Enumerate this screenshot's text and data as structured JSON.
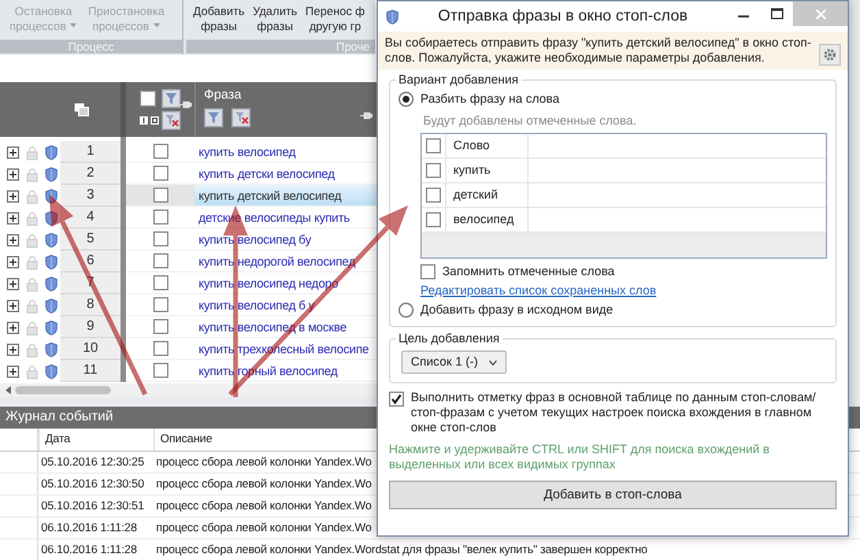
{
  "ribbon": {
    "groups": [
      {
        "label": "Процесс",
        "buttons": [
          {
            "lines": [
              "Остановка",
              "процессов"
            ],
            "has_menu": true,
            "disabled": true
          },
          {
            "lines": [
              "Приостановка",
              "процессов"
            ],
            "has_menu": true,
            "disabled": true
          }
        ]
      },
      {
        "label": "Проче",
        "buttons": [
          {
            "lines": [
              "Добавить",
              "фразы"
            ],
            "has_menu": false,
            "disabled": false
          },
          {
            "lines": [
              "Удалить",
              "фразы"
            ],
            "has_menu": false,
            "disabled": false
          },
          {
            "lines": [
              "Перенос ф",
              "другую гр"
            ],
            "has_menu": false,
            "disabled": false
          }
        ]
      }
    ]
  },
  "grid": {
    "phrase_column": "Фраза",
    "all_checked": false,
    "rows": [
      {
        "number": "1",
        "checked": false,
        "selected": false,
        "phrase": "купить велосипед"
      },
      {
        "number": "2",
        "checked": false,
        "selected": false,
        "phrase": "купить детски велосипед"
      },
      {
        "number": "3",
        "checked": false,
        "selected": true,
        "phrase": "купить детский велосипед"
      },
      {
        "number": "4",
        "checked": false,
        "selected": false,
        "phrase": "детские велосипеды купить"
      },
      {
        "number": "5",
        "checked": false,
        "selected": false,
        "phrase": "купить велосипед бу"
      },
      {
        "number": "6",
        "checked": false,
        "selected": false,
        "phrase": "купить недорогой велосипед"
      },
      {
        "number": "7",
        "checked": false,
        "selected": false,
        "phrase": "купить велосипед недоро"
      },
      {
        "number": "8",
        "checked": false,
        "selected": false,
        "phrase": "купить велосипед б у"
      },
      {
        "number": "9",
        "checked": false,
        "selected": false,
        "phrase": "купить велосипед в москве"
      },
      {
        "number": "10",
        "checked": false,
        "selected": false,
        "phrase": "купить трехколесный велосипе"
      },
      {
        "number": "11",
        "checked": false,
        "selected": false,
        "phrase": "купить горный велосипед"
      }
    ]
  },
  "event_log": {
    "title": "Журнал событий",
    "columns": [
      "Дата",
      "Описание"
    ],
    "rows": [
      {
        "date": "05.10.2016 12:30:25",
        "description": "процесс сбора левой колонки Yandex.Wo"
      },
      {
        "date": "05.10.2016 12:30:50",
        "description": "процесс сбора левой колонки Yandex.Wo"
      },
      {
        "date": "05.10.2016 12:30:51",
        "description": "процесс сбора левой колонки Yandex.Wo"
      },
      {
        "date": "06.10.2016 1:11:28",
        "description": "процесс сбора левой колонки Yandex.Wo"
      },
      {
        "date": "06.10.2016 1:11:28",
        "description": "процесс сбора левой колонки Yandex.Wordstat для фразы \"велек купить\" завершен корректно"
      }
    ]
  },
  "dialog": {
    "title": "Отправка фразы в окно стоп-слов",
    "message": "Вы собираетесь отправить фразу \"купить детский велосипед\" в окно стоп-слов. Пожалуйста, укажите необходимые параметры добавления.",
    "mode_group": {
      "label": "Вариант добавления",
      "options": [
        {
          "label": "Разбить фразу на слова",
          "selected": true
        },
        {
          "label": "Добавить фразу в исходном виде",
          "selected": false
        }
      ],
      "hint": "Будут добавлены отмеченные слова.",
      "words_column": "Слово",
      "all_checked": false,
      "words": [
        {
          "word": "купить",
          "checked": false
        },
        {
          "word": "детский",
          "checked": false
        },
        {
          "word": "велосипед",
          "checked": false
        }
      ],
      "remember": {
        "label": "Запомнить отмеченные слова",
        "checked": false
      },
      "edit_link": "Редактировать список сохраненных слов"
    },
    "target_group": {
      "label": "Цель добавления",
      "value": "Список 1 (-)"
    },
    "mark_option": {
      "label": "Выполнить отметку фраз в основной таблице по данным стоп-словам/стоп-фразам с учетом текущих настроек поиска вхождения в главном окне стоп-слов",
      "checked": true
    },
    "hint": "Нажмите и удерживайте CTRL или SHIFT для поиска вхождений в выделенных или всех видимых группах",
    "submit": "Добавить в стоп-слова"
  }
}
